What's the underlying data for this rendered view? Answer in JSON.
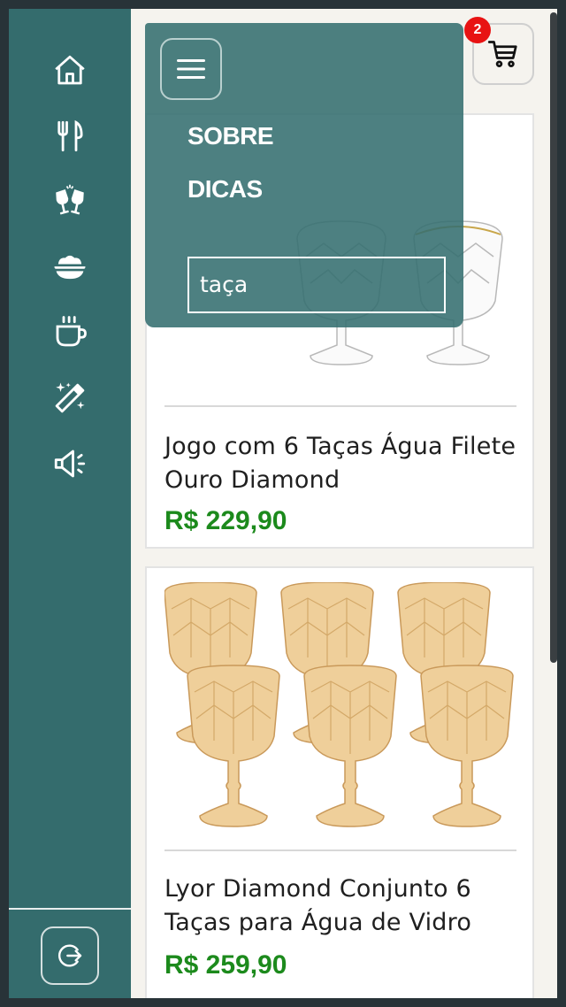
{
  "sidebar": {
    "icons": [
      "home-icon",
      "utensils-icon",
      "toast-glasses-icon",
      "bowl-icon",
      "mug-icon",
      "magic-wand-icon",
      "megaphone-icon"
    ],
    "logout_icon": "logout-icon"
  },
  "menu": {
    "links": [
      "SOBRE",
      "DICAS"
    ],
    "search_value": "taça"
  },
  "cart": {
    "count": "2"
  },
  "products": [
    {
      "title": "Jogo com 6 Taças Água Filete Ouro Diamond",
      "price": "R$ 229,90"
    },
    {
      "title": "Lyor Diamond Conjunto 6 Taças para Água de Vidro",
      "price": "R$ 259,90"
    }
  ],
  "colors": {
    "sidebar": "#346c6d",
    "price": "#1c8a1c",
    "badge": "#e81313",
    "background": "#f5f3ee"
  }
}
